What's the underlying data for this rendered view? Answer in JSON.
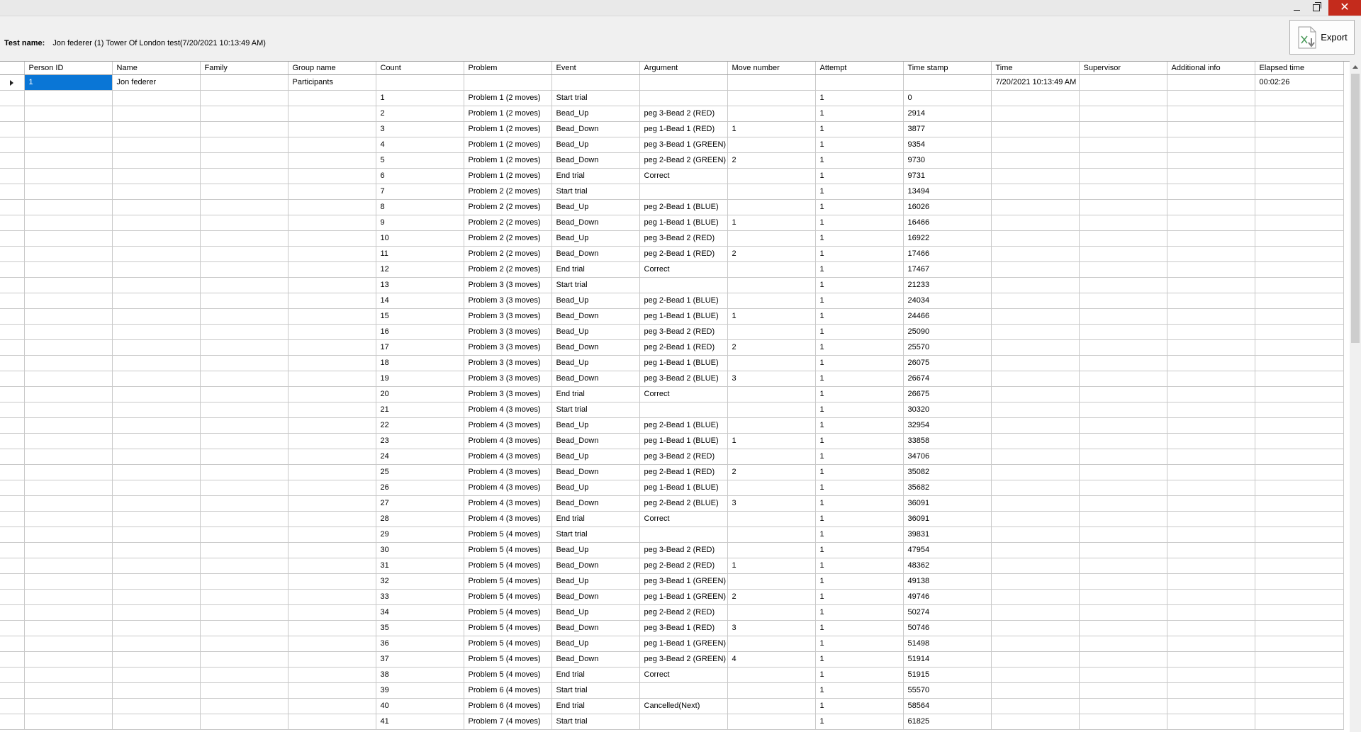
{
  "window": {
    "minimize_icon": "minimize-icon",
    "restore_icon": "restore-icon",
    "close_icon": "close-icon",
    "close_glyph": "✕"
  },
  "test": {
    "label": "Test name:",
    "value": "Jon federer  (1) Tower Of London test(7/20/2021 10:13:49 AM)"
  },
  "export": {
    "label": "Export",
    "icon": "excel-export-icon"
  },
  "colors": {
    "selection": "#0a76d6",
    "close": "#c42b1c"
  },
  "grid": {
    "columns": [
      "Person ID",
      "Name",
      "Family",
      "Group name",
      "Count",
      "Problem",
      "Event",
      "Argument",
      "Move number",
      "Attempt",
      "Time stamp",
      "Time",
      "Supervisor",
      "Additional info",
      "Elapsed time"
    ],
    "rows": [
      [
        "1",
        "Jon federer",
        "",
        "Participants",
        "",
        "",
        "",
        "",
        "",
        "",
        "",
        "7/20/2021 10:13:49 AM",
        "",
        "",
        "00:02:26"
      ],
      [
        "",
        "",
        "",
        "",
        "1",
        "Problem 1 (2 moves)",
        "Start trial",
        "",
        "",
        "1",
        "0",
        "",
        "",
        "",
        ""
      ],
      [
        "",
        "",
        "",
        "",
        "2",
        "Problem 1 (2 moves)",
        "Bead_Up",
        "peg 3-Bead 2 (RED)",
        "",
        "1",
        "2914",
        "",
        "",
        "",
        ""
      ],
      [
        "",
        "",
        "",
        "",
        "3",
        "Problem 1 (2 moves)",
        "Bead_Down",
        "peg 1-Bead 1 (RED)",
        "1",
        "1",
        "3877",
        "",
        "",
        "",
        ""
      ],
      [
        "",
        "",
        "",
        "",
        "4",
        "Problem 1 (2 moves)",
        "Bead_Up",
        "peg 3-Bead 1 (GREEN)",
        "",
        "1",
        "9354",
        "",
        "",
        "",
        ""
      ],
      [
        "",
        "",
        "",
        "",
        "5",
        "Problem 1 (2 moves)",
        "Bead_Down",
        "peg 2-Bead 2 (GREEN)",
        "2",
        "1",
        "9730",
        "",
        "",
        "",
        ""
      ],
      [
        "",
        "",
        "",
        "",
        "6",
        "Problem 1 (2 moves)",
        "End trial",
        "Correct",
        "",
        "1",
        "9731",
        "",
        "",
        "",
        ""
      ],
      [
        "",
        "",
        "",
        "",
        "7",
        "Problem 2 (2 moves)",
        "Start trial",
        "",
        "",
        "1",
        "13494",
        "",
        "",
        "",
        ""
      ],
      [
        "",
        "",
        "",
        "",
        "8",
        "Problem 2 (2 moves)",
        "Bead_Up",
        "peg 2-Bead 1 (BLUE)",
        "",
        "1",
        "16026",
        "",
        "",
        "",
        ""
      ],
      [
        "",
        "",
        "",
        "",
        "9",
        "Problem 2 (2 moves)",
        "Bead_Down",
        "peg 1-Bead 1 (BLUE)",
        "1",
        "1",
        "16466",
        "",
        "",
        "",
        ""
      ],
      [
        "",
        "",
        "",
        "",
        "10",
        "Problem 2 (2 moves)",
        "Bead_Up",
        "peg 3-Bead 2 (RED)",
        "",
        "1",
        "16922",
        "",
        "",
        "",
        ""
      ],
      [
        "",
        "",
        "",
        "",
        "11",
        "Problem 2 (2 moves)",
        "Bead_Down",
        "peg 2-Bead 1 (RED)",
        "2",
        "1",
        "17466",
        "",
        "",
        "",
        ""
      ],
      [
        "",
        "",
        "",
        "",
        "12",
        "Problem 2 (2 moves)",
        "End trial",
        "Correct",
        "",
        "1",
        "17467",
        "",
        "",
        "",
        ""
      ],
      [
        "",
        "",
        "",
        "",
        "13",
        "Problem 3 (3 moves)",
        "Start trial",
        "",
        "",
        "1",
        "21233",
        "",
        "",
        "",
        ""
      ],
      [
        "",
        "",
        "",
        "",
        "14",
        "Problem 3 (3 moves)",
        "Bead_Up",
        "peg 2-Bead 1 (BLUE)",
        "",
        "1",
        "24034",
        "",
        "",
        "",
        ""
      ],
      [
        "",
        "",
        "",
        "",
        "15",
        "Problem 3 (3 moves)",
        "Bead_Down",
        "peg 1-Bead 1 (BLUE)",
        "1",
        "1",
        "24466",
        "",
        "",
        "",
        ""
      ],
      [
        "",
        "",
        "",
        "",
        "16",
        "Problem 3 (3 moves)",
        "Bead_Up",
        "peg 3-Bead 2 (RED)",
        "",
        "1",
        "25090",
        "",
        "",
        "",
        ""
      ],
      [
        "",
        "",
        "",
        "",
        "17",
        "Problem 3 (3 moves)",
        "Bead_Down",
        "peg 2-Bead 1 (RED)",
        "2",
        "1",
        "25570",
        "",
        "",
        "",
        ""
      ],
      [
        "",
        "",
        "",
        "",
        "18",
        "Problem 3 (3 moves)",
        "Bead_Up",
        "peg 1-Bead 1 (BLUE)",
        "",
        "1",
        "26075",
        "",
        "",
        "",
        ""
      ],
      [
        "",
        "",
        "",
        "",
        "19",
        "Problem 3 (3 moves)",
        "Bead_Down",
        "peg 3-Bead 2 (BLUE)",
        "3",
        "1",
        "26674",
        "",
        "",
        "",
        ""
      ],
      [
        "",
        "",
        "",
        "",
        "20",
        "Problem 3 (3 moves)",
        "End trial",
        "Correct",
        "",
        "1",
        "26675",
        "",
        "",
        "",
        ""
      ],
      [
        "",
        "",
        "",
        "",
        "21",
        "Problem 4 (3 moves)",
        "Start trial",
        "",
        "",
        "1",
        "30320",
        "",
        "",
        "",
        ""
      ],
      [
        "",
        "",
        "",
        "",
        "22",
        "Problem 4 (3 moves)",
        "Bead_Up",
        "peg 2-Bead 1 (BLUE)",
        "",
        "1",
        "32954",
        "",
        "",
        "",
        ""
      ],
      [
        "",
        "",
        "",
        "",
        "23",
        "Problem 4 (3 moves)",
        "Bead_Down",
        "peg 1-Bead 1 (BLUE)",
        "1",
        "1",
        "33858",
        "",
        "",
        "",
        ""
      ],
      [
        "",
        "",
        "",
        "",
        "24",
        "Problem 4 (3 moves)",
        "Bead_Up",
        "peg 3-Bead 2 (RED)",
        "",
        "1",
        "34706",
        "",
        "",
        "",
        ""
      ],
      [
        "",
        "",
        "",
        "",
        "25",
        "Problem 4 (3 moves)",
        "Bead_Down",
        "peg 2-Bead 1 (RED)",
        "2",
        "1",
        "35082",
        "",
        "",
        "",
        ""
      ],
      [
        "",
        "",
        "",
        "",
        "26",
        "Problem 4 (3 moves)",
        "Bead_Up",
        "peg 1-Bead 1 (BLUE)",
        "",
        "1",
        "35682",
        "",
        "",
        "",
        ""
      ],
      [
        "",
        "",
        "",
        "",
        "27",
        "Problem 4 (3 moves)",
        "Bead_Down",
        "peg 2-Bead 2 (BLUE)",
        "3",
        "1",
        "36091",
        "",
        "",
        "",
        ""
      ],
      [
        "",
        "",
        "",
        "",
        "28",
        "Problem 4 (3 moves)",
        "End trial",
        "Correct",
        "",
        "1",
        "36091",
        "",
        "",
        "",
        ""
      ],
      [
        "",
        "",
        "",
        "",
        "29",
        "Problem 5 (4 moves)",
        "Start trial",
        "",
        "",
        "1",
        "39831",
        "",
        "",
        "",
        ""
      ],
      [
        "",
        "",
        "",
        "",
        "30",
        "Problem 5 (4 moves)",
        "Bead_Up",
        "peg 3-Bead 2 (RED)",
        "",
        "1",
        "47954",
        "",
        "",
        "",
        ""
      ],
      [
        "",
        "",
        "",
        "",
        "31",
        "Problem 5 (4 moves)",
        "Bead_Down",
        "peg 2-Bead 2 (RED)",
        "1",
        "1",
        "48362",
        "",
        "",
        "",
        ""
      ],
      [
        "",
        "",
        "",
        "",
        "32",
        "Problem 5 (4 moves)",
        "Bead_Up",
        "peg 3-Bead 1 (GREEN)",
        "",
        "1",
        "49138",
        "",
        "",
        "",
        ""
      ],
      [
        "",
        "",
        "",
        "",
        "33",
        "Problem 5 (4 moves)",
        "Bead_Down",
        "peg 1-Bead 1 (GREEN)",
        "2",
        "1",
        "49746",
        "",
        "",
        "",
        ""
      ],
      [
        "",
        "",
        "",
        "",
        "34",
        "Problem 5 (4 moves)",
        "Bead_Up",
        "peg 2-Bead 2 (RED)",
        "",
        "1",
        "50274",
        "",
        "",
        "",
        ""
      ],
      [
        "",
        "",
        "",
        "",
        "35",
        "Problem 5 (4 moves)",
        "Bead_Down",
        "peg 3-Bead 1 (RED)",
        "3",
        "1",
        "50746",
        "",
        "",
        "",
        ""
      ],
      [
        "",
        "",
        "",
        "",
        "36",
        "Problem 5 (4 moves)",
        "Bead_Up",
        "peg 1-Bead 1 (GREEN)",
        "",
        "1",
        "51498",
        "",
        "",
        "",
        ""
      ],
      [
        "",
        "",
        "",
        "",
        "37",
        "Problem 5 (4 moves)",
        "Bead_Down",
        "peg 3-Bead 2 (GREEN)",
        "4",
        "1",
        "51914",
        "",
        "",
        "",
        ""
      ],
      [
        "",
        "",
        "",
        "",
        "38",
        "Problem 5 (4 moves)",
        "End trial",
        "Correct",
        "",
        "1",
        "51915",
        "",
        "",
        "",
        ""
      ],
      [
        "",
        "",
        "",
        "",
        "39",
        "Problem 6 (4 moves)",
        "Start trial",
        "",
        "",
        "1",
        "55570",
        "",
        "",
        "",
        ""
      ],
      [
        "",
        "",
        "",
        "",
        "40",
        "Problem 6 (4 moves)",
        "End trial",
        "Cancelled(Next)",
        "",
        "1",
        "58564",
        "",
        "",
        "",
        ""
      ],
      [
        "",
        "",
        "",
        "",
        "41",
        "Problem 7 (4 moves)",
        "Start trial",
        "",
        "",
        "1",
        "61825",
        "",
        "",
        "",
        ""
      ]
    ]
  }
}
